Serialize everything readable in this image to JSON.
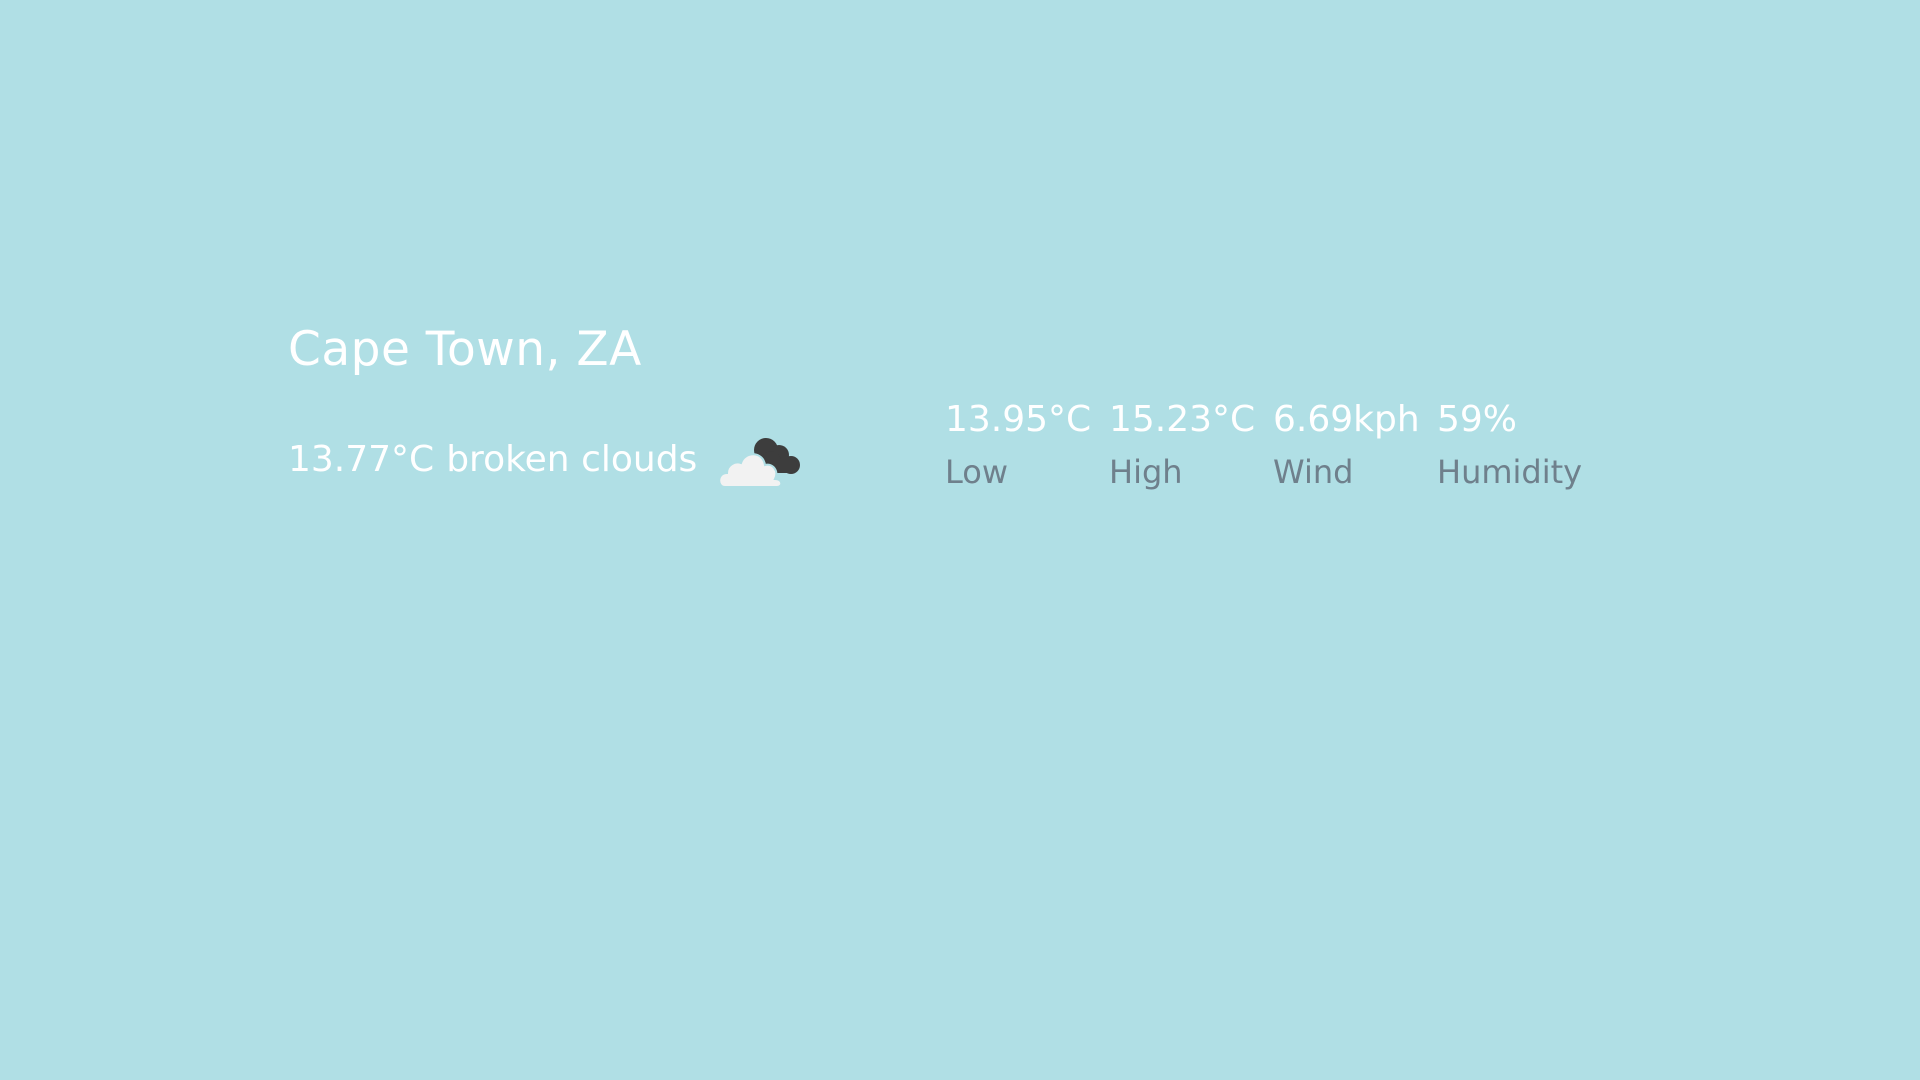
{
  "location": "Cape Town, ZA",
  "current": {
    "temperature": "13.77°C",
    "description": "broken clouds",
    "icon": "broken-clouds-icon"
  },
  "stats": [
    {
      "value": "13.95°C",
      "label": "Low"
    },
    {
      "value": "15.23°C",
      "label": "High"
    },
    {
      "value": "6.69kph",
      "label": "Wind"
    },
    {
      "value": "59%",
      "label": "Humidity"
    }
  ],
  "colors": {
    "background": "#b0dfe5",
    "primary_text": "#ffffff",
    "secondary_text": "#6f808c",
    "cloud_light": "#f2f2f2",
    "cloud_dark": "#3d3d3d"
  }
}
